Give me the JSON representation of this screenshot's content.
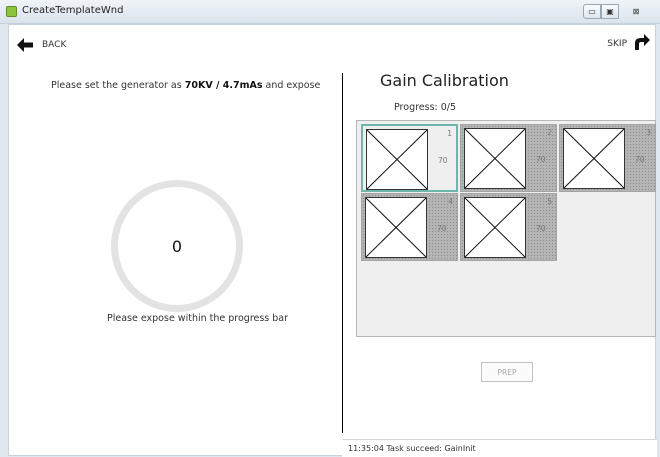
{
  "window": {
    "title": "CreateTemplateWnd"
  },
  "nav": {
    "back_label": "BACK",
    "skip_label": "SKIP"
  },
  "left": {
    "instruction_prefix": "Please set the generator as ",
    "instruction_value": "70KV / 4.7mAs",
    "instruction_suffix": " and expose",
    "ring_value": "0",
    "hint": "Please expose within the progress bar"
  },
  "right": {
    "title": "Gain Calibration",
    "progress_label": "Progress:  0/5",
    "cells": [
      {
        "index": "1",
        "kv": "70",
        "active": true
      },
      {
        "index": "2",
        "kv": "70",
        "active": false
      },
      {
        "index": "3",
        "kv": "70",
        "active": false
      },
      {
        "index": "4",
        "kv": "70",
        "active": false
      },
      {
        "index": "5",
        "kv": "70",
        "active": false
      }
    ],
    "prep_label": "PREP"
  },
  "status": {
    "text": "11:35:04 Task succeed: GainInit"
  },
  "colors": {
    "accent": "#6fb5ad",
    "app_icon": "#8cc43e"
  },
  "icons": {
    "back": "arrow-left-icon",
    "skip": "curved-arrow-right-icon",
    "thumb": "x-placeholder-icon"
  }
}
